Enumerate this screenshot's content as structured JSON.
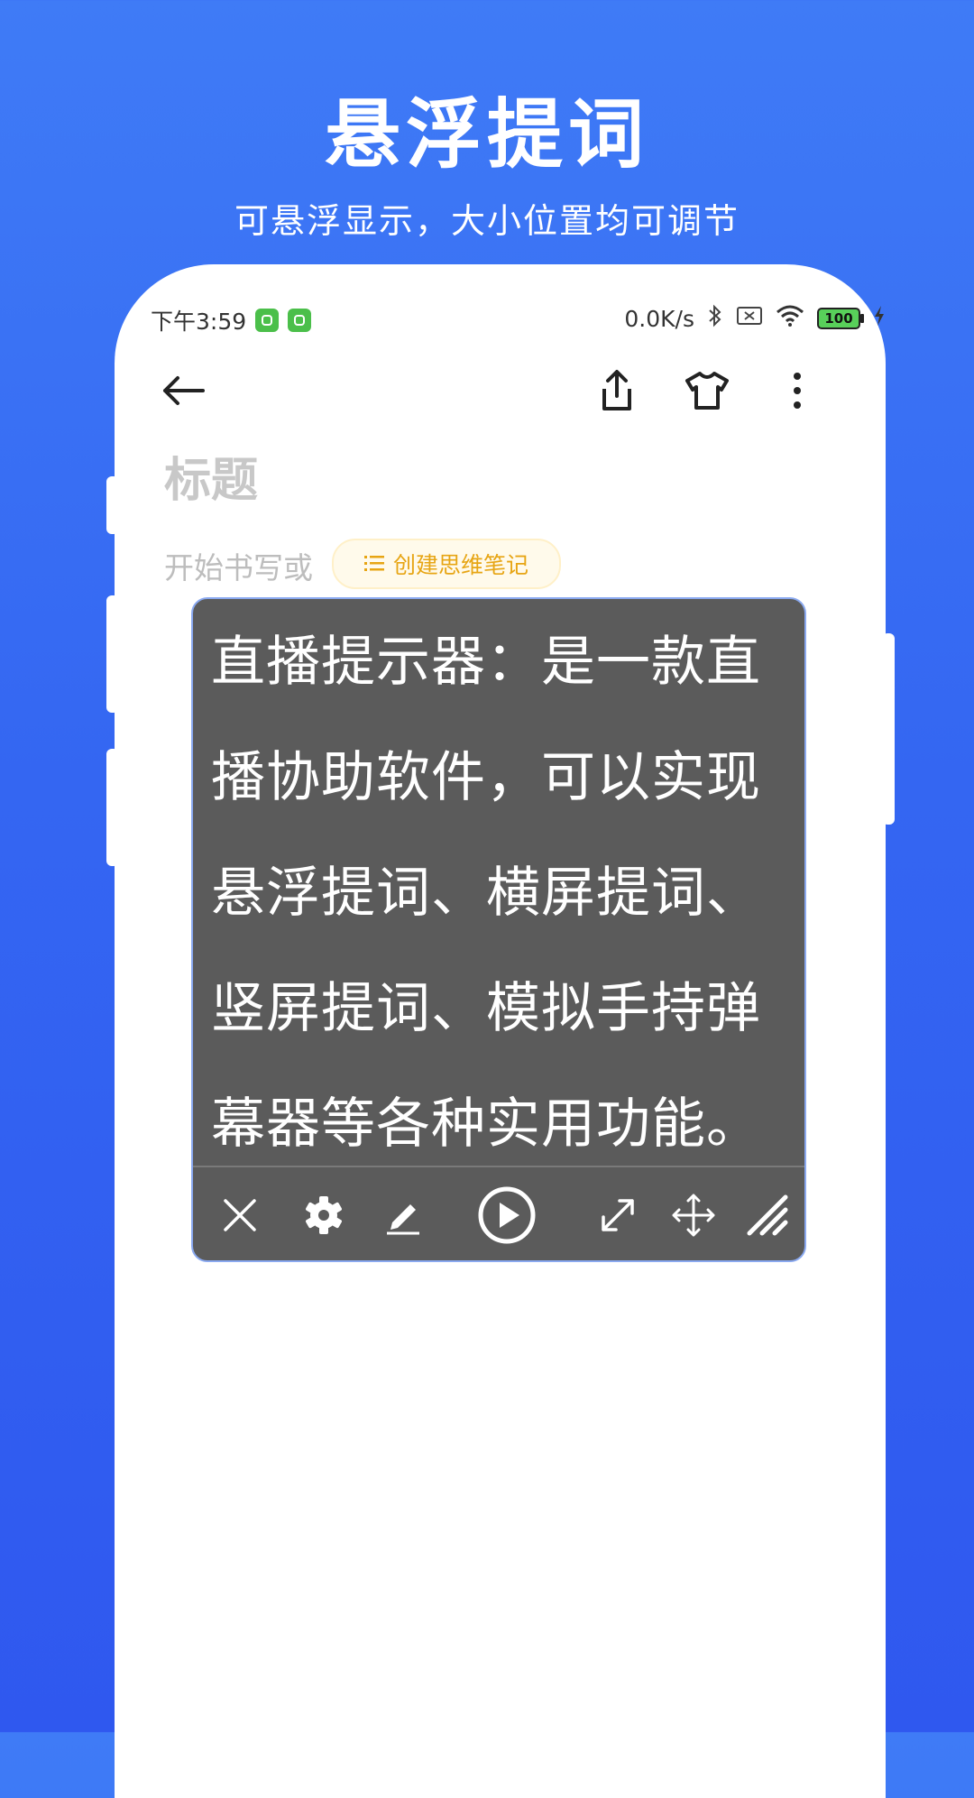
{
  "promo": {
    "title": "悬浮提词",
    "subtitle": "可悬浮显示，大小位置均可调节"
  },
  "status_bar": {
    "time": "下午3:59",
    "net_speed": "0.0K/s",
    "battery": "100"
  },
  "toolbar": {
    "back_icon": "back-arrow-icon",
    "share_icon": "share-icon",
    "theme_icon": "tshirt-icon",
    "more_icon": "more-vertical-icon"
  },
  "note": {
    "title_placeholder": "标题",
    "body_hint": "开始书写或",
    "mind_note_button": "创建思维笔记"
  },
  "floating_prompter": {
    "text": "直播提示器：是一款直播协助软件，可以实现悬浮提词、横屏提词、竖屏提词、模拟手持弹幕器等各种实用功能。",
    "border_color": "#8aa9f0",
    "background": "#5b5b5b",
    "controls": [
      "close-icon",
      "settings-gear-icon",
      "edit-pencil-icon",
      "play-icon",
      "expand-icon",
      "move-icon",
      "resize-handle-icon"
    ]
  },
  "colors": {
    "background_top": "#3f7bf6",
    "background_bottom": "#2f58ef",
    "accent_yellow": "#e7a514"
  }
}
